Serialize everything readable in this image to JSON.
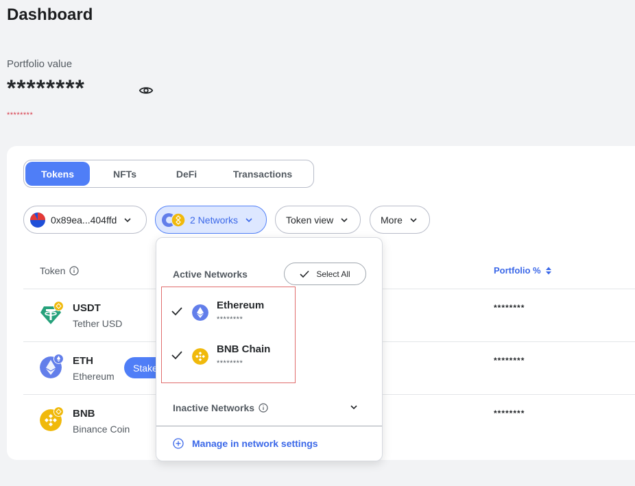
{
  "header": {
    "title": "Dashboard",
    "portfolio_label": "Portfolio value",
    "portfolio_value": "********",
    "portfolio_change": "********"
  },
  "tabs": [
    {
      "label": "Tokens",
      "active": true
    },
    {
      "label": "NFTs",
      "active": false
    },
    {
      "label": "DeFi",
      "active": false
    },
    {
      "label": "Transactions",
      "active": false
    }
  ],
  "filters": {
    "account": "0x89ea...404ffd",
    "networks": "2 Networks",
    "token_view": "Token view",
    "more": "More"
  },
  "network_dropdown": {
    "active_label": "Active Networks",
    "select_all": "Select All",
    "networks": [
      {
        "name": "Ethereum",
        "value": "********",
        "icon": "ethereum-icon",
        "checked": true
      },
      {
        "name": "BNB Chain",
        "value": "********",
        "icon": "bnb-icon",
        "checked": true
      }
    ],
    "inactive_label": "Inactive Networks",
    "manage_label": "Manage in network settings"
  },
  "table": {
    "col_token": "Token",
    "col_portfolio": "Portfolio %",
    "rows": [
      {
        "symbol": "USDT",
        "name": "Tether USD",
        "portfolio": "********",
        "icon": "tether-icon"
      },
      {
        "symbol": "ETH",
        "name": "Ethereum",
        "portfolio": "********",
        "icon": "ethereum-icon",
        "stake": "Stake"
      },
      {
        "symbol": "BNB",
        "name": "Binance Coin",
        "portfolio": "********",
        "icon": "bnb-icon"
      }
    ]
  },
  "colors": {
    "accent": "#4f7ef7",
    "accent_text": "#3a67e8",
    "negative": "#d73847",
    "ethereum": "#627eea",
    "bnb": "#f0b90b",
    "tether": "#26a17b"
  }
}
